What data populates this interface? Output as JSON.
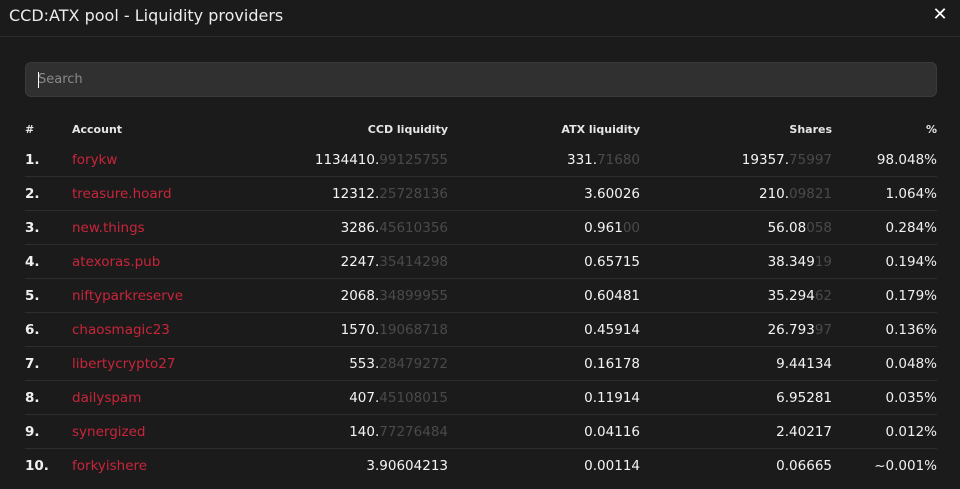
{
  "header": {
    "title": "CCD:ATX pool - Liquidity providers",
    "close_label": "✕"
  },
  "search": {
    "placeholder": "Search",
    "value": ""
  },
  "table": {
    "columns": [
      "#",
      "Account",
      "CCD liquidity",
      "ATX liquidity",
      "Shares",
      "%"
    ],
    "rows": [
      {
        "rank": "1.",
        "account": "forykw",
        "ccd_int": "1134410.",
        "ccd_frac": "99125755",
        "atx_int": "331.",
        "atx_frac": "71680",
        "shares_int": "19357.",
        "shares_frac": "75997",
        "pct": "98.048%"
      },
      {
        "rank": "2.",
        "account": "treasure.hoard",
        "ccd_int": "12312.",
        "ccd_frac": "25728136",
        "atx_int": "3.60026",
        "atx_frac": "",
        "shares_int": "210.",
        "shares_frac": "09821",
        "pct": "1.064%"
      },
      {
        "rank": "3.",
        "account": "new.things",
        "ccd_int": "3286.",
        "ccd_frac": "45610356",
        "atx_int": "0.961",
        "atx_frac": "00",
        "shares_int": "56.08",
        "shares_frac": "058",
        "pct": "0.284%"
      },
      {
        "rank": "4.",
        "account": "atexoras.pub",
        "ccd_int": "2247.",
        "ccd_frac": "35414298",
        "atx_int": "0.65715",
        "atx_frac": "",
        "shares_int": "38.349",
        "shares_frac": "19",
        "pct": "0.194%"
      },
      {
        "rank": "5.",
        "account": "niftyparkreserve",
        "ccd_int": "2068.",
        "ccd_frac": "34899955",
        "atx_int": "0.60481",
        "atx_frac": "",
        "shares_int": "35.294",
        "shares_frac": "62",
        "pct": "0.179%"
      },
      {
        "rank": "6.",
        "account": "chaosmagic23",
        "ccd_int": "1570.",
        "ccd_frac": "19068718",
        "atx_int": "0.45914",
        "atx_frac": "",
        "shares_int": "26.793",
        "shares_frac": "97",
        "pct": "0.136%"
      },
      {
        "rank": "7.",
        "account": "libertycrypto27",
        "ccd_int": "553.",
        "ccd_frac": "28479272",
        "atx_int": "0.16178",
        "atx_frac": "",
        "shares_int": "9.44134",
        "shares_frac": "",
        "pct": "0.048%"
      },
      {
        "rank": "8.",
        "account": "dailyspam",
        "ccd_int": "407.",
        "ccd_frac": "45108015",
        "atx_int": "0.11914",
        "atx_frac": "",
        "shares_int": "6.95281",
        "shares_frac": "",
        "pct": "0.035%"
      },
      {
        "rank": "9.",
        "account": "synergized",
        "ccd_int": "140.",
        "ccd_frac": "77276484",
        "atx_int": "0.04116",
        "atx_frac": "",
        "shares_int": "2.40217",
        "shares_frac": "",
        "pct": "0.012%"
      },
      {
        "rank": "10.",
        "account": "forkyishere",
        "ccd_int": "3.90604213",
        "ccd_frac": "",
        "atx_int": "0.00114",
        "atx_frac": "",
        "shares_int": "0.06665",
        "shares_frac": "",
        "pct": "~0.001%"
      }
    ]
  },
  "colors": {
    "background": "#1b1b1b",
    "account_link": "#c9253a",
    "dim_digits": "#4a4a4a"
  }
}
